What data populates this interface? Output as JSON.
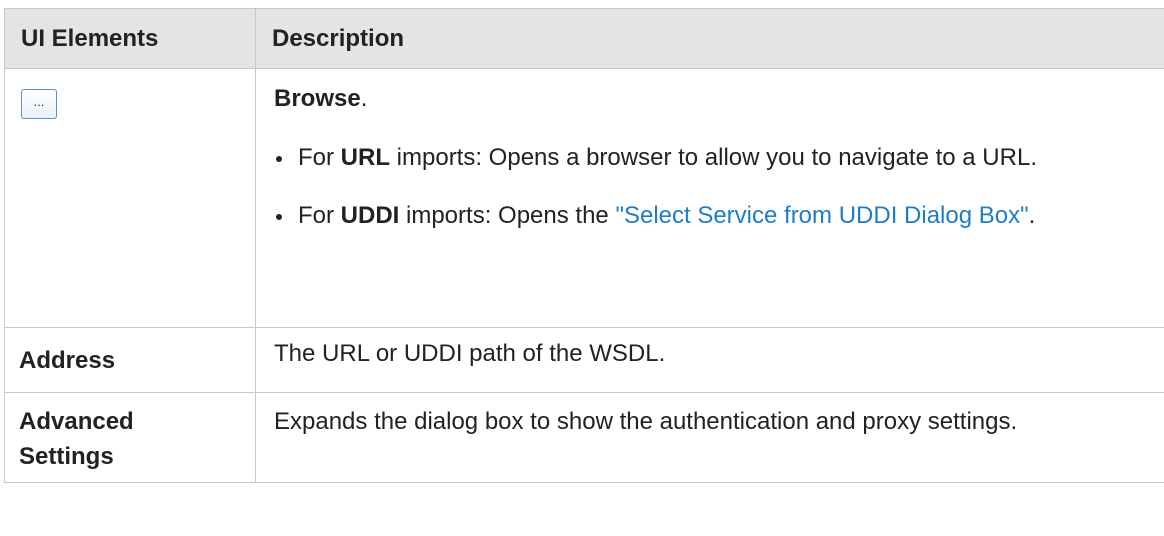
{
  "table": {
    "headers": [
      "UI Elements",
      "Description"
    ],
    "browse_row": {
      "button_label": "...",
      "title": "Browse",
      "title_trail": ".",
      "bullets": [
        {
          "prefix": "For ",
          "bold": "URL",
          "text": " imports: Opens a browser to allow you to navigate to a URL."
        },
        {
          "prefix": "For ",
          "bold": "UDDI",
          "text": " imports: Opens the ",
          "link": "\"Select Service from UDDI Dialog Box\"",
          "suffix": "."
        }
      ]
    },
    "address_row": {
      "element": "Address",
      "description": "The URL or UDDI path of the WSDL."
    },
    "advanced_row": {
      "element_line1": "Advanced",
      "element_line2": "Settings",
      "description": "Expands the dialog box to show the authentication and proxy settings."
    }
  },
  "colors": {
    "header_bg": "#e4e4e4",
    "border": "#c8c8c8",
    "link": "#1d7ec4",
    "text": "#222222"
  }
}
